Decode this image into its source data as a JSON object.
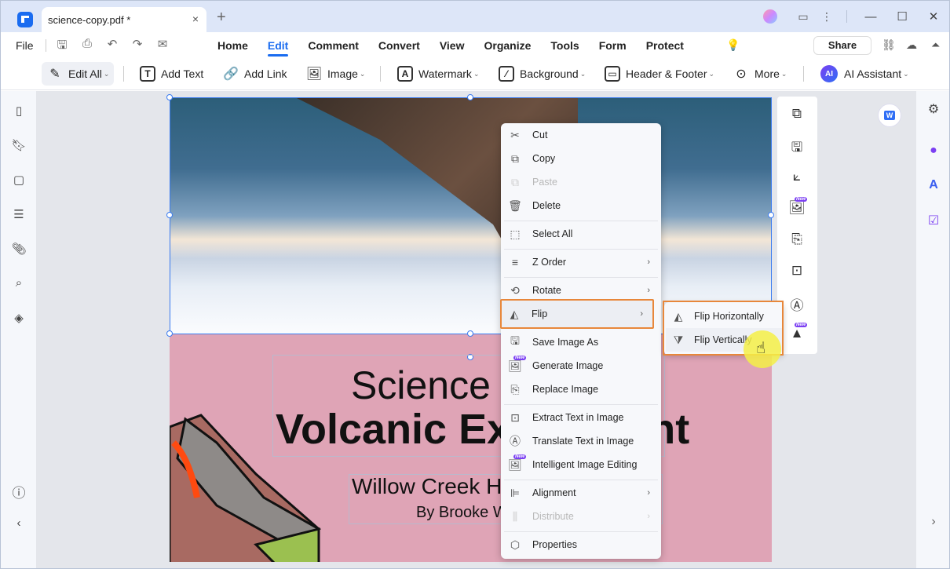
{
  "window": {
    "tab_title": "science-copy.pdf *",
    "tab_close": "×",
    "new_tab": "+",
    "controls": {
      "minimize": "—",
      "maximize": "☐",
      "close": "✕"
    }
  },
  "menu": {
    "file": "File",
    "tabs": [
      "Home",
      "Edit",
      "Comment",
      "Convert",
      "View",
      "Organize",
      "Tools",
      "Form",
      "Protect"
    ],
    "active_tab": "Edit",
    "share": "Share"
  },
  "toolbar": {
    "edit_all": "Edit All",
    "add_text": "Add Text",
    "add_link": "Add Link",
    "image": "Image",
    "watermark": "Watermark",
    "background": "Background",
    "header_footer": "Header & Footer",
    "more": "More",
    "ai_assistant": "AI Assistant",
    "ai_badge": "AI"
  },
  "document": {
    "title_line1": "Science",
    "title_line2": "Volcanic Experiment",
    "subtitle": "Willow Creek High School",
    "author": "By Brooke Wells"
  },
  "context_menu": {
    "items": [
      {
        "label": "Cut",
        "icon": "scissors-icon",
        "enabled": true
      },
      {
        "label": "Copy",
        "icon": "copy-icon",
        "enabled": true
      },
      {
        "label": "Paste",
        "icon": "paste-icon",
        "enabled": false
      },
      {
        "label": "Delete",
        "icon": "trash-icon",
        "enabled": true
      },
      {
        "label": "Select All",
        "icon": "select-all-icon",
        "enabled": true
      },
      {
        "label": "Z Order",
        "icon": "z-order-icon",
        "enabled": true,
        "submenu": true
      },
      {
        "label": "Rotate",
        "icon": "rotate-icon",
        "enabled": true,
        "submenu": true
      },
      {
        "label": "Flip",
        "icon": "flip-icon",
        "enabled": true,
        "submenu": true,
        "highlighted": true
      },
      {
        "label": "Save Image As",
        "icon": "save-icon",
        "enabled": true
      },
      {
        "label": "Generate Image",
        "icon": "generate-image-icon",
        "enabled": true,
        "badge": "New"
      },
      {
        "label": "Replace Image",
        "icon": "replace-image-icon",
        "enabled": true
      },
      {
        "label": "Extract Text in Image",
        "icon": "ocr-icon",
        "enabled": true
      },
      {
        "label": "Translate Text in Image",
        "icon": "translate-icon",
        "enabled": true
      },
      {
        "label": "Intelligent Image Editing",
        "icon": "image-edit-icon",
        "enabled": true,
        "badge": "New"
      },
      {
        "label": "Alignment",
        "icon": "align-icon",
        "enabled": true,
        "submenu": true
      },
      {
        "label": "Distribute",
        "icon": "distribute-icon",
        "enabled": false,
        "submenu": true
      },
      {
        "label": "Properties",
        "icon": "properties-icon",
        "enabled": true
      }
    ]
  },
  "flip_submenu": {
    "items": [
      {
        "label": "Flip Horizontally"
      },
      {
        "label": "Flip Vertically",
        "hovered": true
      }
    ]
  },
  "badges": {
    "new": "New"
  },
  "colors": {
    "accent": "#1a6cf0",
    "highlight": "#e8873a",
    "page_bg": "#dfa4b6"
  }
}
